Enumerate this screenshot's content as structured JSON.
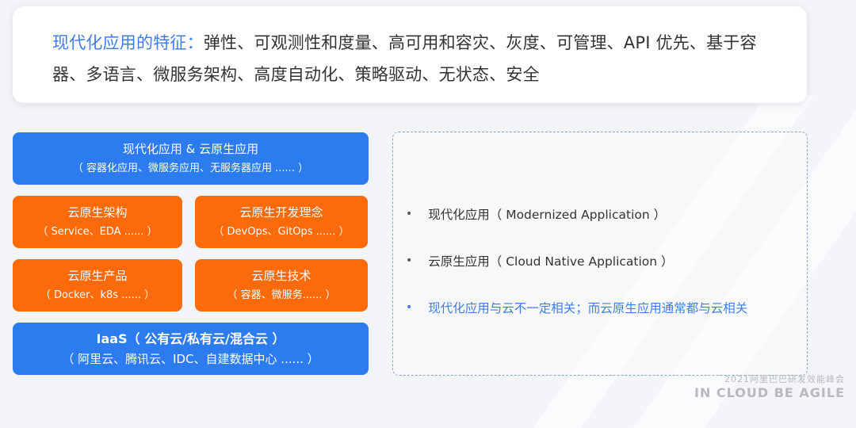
{
  "header": {
    "highlight": "现代化应用的特征：",
    "body": "弹性、可观测性和度量、高可用和容灾、灰度、可管理、API 优先、基于容器、多语言、微服务架构、高度自动化、策略驱动、无状态、安全"
  },
  "stack": {
    "top": {
      "title": "现代化应用 & 云原生应用",
      "sub": "（ 容器化应用、微服务应用、无服务器应用 ...... ）"
    },
    "arch": {
      "title": "云原生架构",
      "sub": "（ Service、EDA ...... ）"
    },
    "dev": {
      "title": "云原生开发理念",
      "sub": "（ DevOps、GitOps ...... ）"
    },
    "product": {
      "title": "云原生产品",
      "sub": "（ Docker、k8s ...... ）"
    },
    "tech": {
      "title": "云原生技术",
      "sub": "（ 容器、微服务...... ）"
    },
    "iaas": {
      "title": "IaaS（ 公有云/私有云/混合云 ）",
      "sub": "（ 阿里云、腾讯云、IDC、自建数据中心 ...... ）"
    }
  },
  "bullets": [
    "现代化应用（ Modernized Application ）",
    "云原生应用（ Cloud Native Application ）",
    "现代化应用与云不一定相关；而云原生应用通常都与云相关"
  ],
  "bullet_symbol": "•",
  "footer": {
    "line1": "2021阿里巴巴研发效能峰会",
    "line2": "IN CLOUD BE AGILE"
  },
  "colors": {
    "blue": "#2c7cf0",
    "orange": "#fc6a09",
    "accent_text": "#3b7de9"
  }
}
